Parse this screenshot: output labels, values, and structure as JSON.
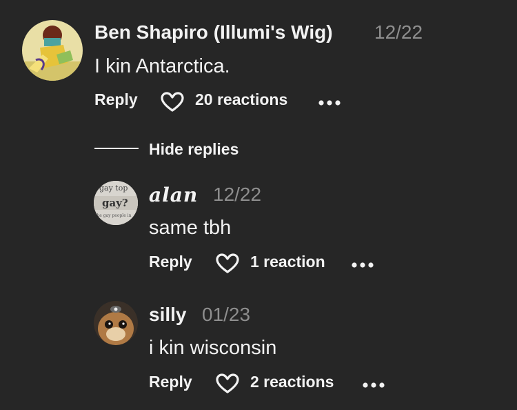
{
  "comments": [
    {
      "author": "Ben Shapiro (Illumi's Wig)",
      "date": "12/22",
      "text": "I kin Antarctica.",
      "reply_label": "Reply",
      "reactions": "20 reactions"
    }
  ],
  "replies_toggle": "Hide replies",
  "replies": [
    {
      "author": "alan",
      "date": "12/22",
      "text": "same tbh",
      "reply_label": "Reply",
      "reactions": "1 reaction",
      "avatar_text": [
        "gay top",
        "gay?",
        "the gay people in"
      ]
    },
    {
      "author": "silly",
      "date": "01/23",
      "text": "i kin wisconsin",
      "reply_label": "Reply",
      "reactions": "2 reactions"
    }
  ]
}
